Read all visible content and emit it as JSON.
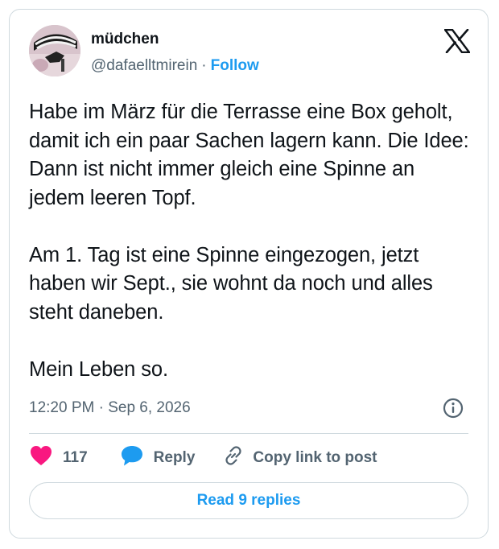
{
  "author": {
    "display_name": "müdchen",
    "handle": "@dafaelltmirein",
    "separator": "·",
    "follow_label": "Follow"
  },
  "tweet": {
    "paragraphs": [
      "Habe im März für die Terrasse eine Box geholt, damit ich ein paar Sachen lagern kann. Die Idee: Dann ist nicht immer gleich eine Spinne an jedem leeren Topf.",
      "Am 1. Tag ist eine Spinne eingezogen, jetzt haben wir Sept., sie wohnt da noch und alles steht daneben.",
      "Mein Leben so."
    ],
    "timestamp": "12:20 PM · Sep 6, 2026"
  },
  "actions": {
    "like_count": "117",
    "reply_label": "Reply",
    "copy_link_label": "Copy link to post"
  },
  "footer": {
    "read_replies_label": "Read 9 replies"
  },
  "icons": {
    "like": "heart-icon",
    "reply": "speech-bubble-icon",
    "copy": "link-icon",
    "info": "info-icon",
    "brand": "x-logo-icon"
  },
  "colors": {
    "accent": "#1d9bf0",
    "like": "#f91880",
    "text": "#0f1419",
    "muted": "#536471",
    "border": "#cfd9de"
  }
}
